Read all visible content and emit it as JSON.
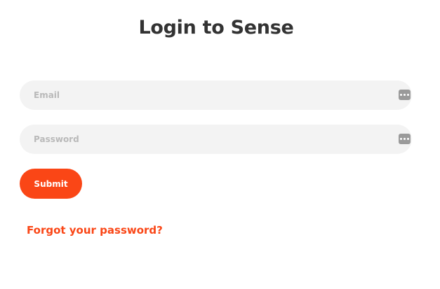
{
  "page": {
    "title": "Login to Sense"
  },
  "form": {
    "email": {
      "value": "",
      "placeholder": "Email",
      "icon": "password-manager-icon"
    },
    "password": {
      "value": "",
      "placeholder": "Password",
      "icon": "password-manager-icon"
    },
    "submit_label": "Submit",
    "forgot_label": "Forgot your password?"
  },
  "colors": {
    "accent": "#fa4616",
    "title": "#333333",
    "field_background": "#f3f3f3",
    "placeholder": "#b9b9b9"
  }
}
